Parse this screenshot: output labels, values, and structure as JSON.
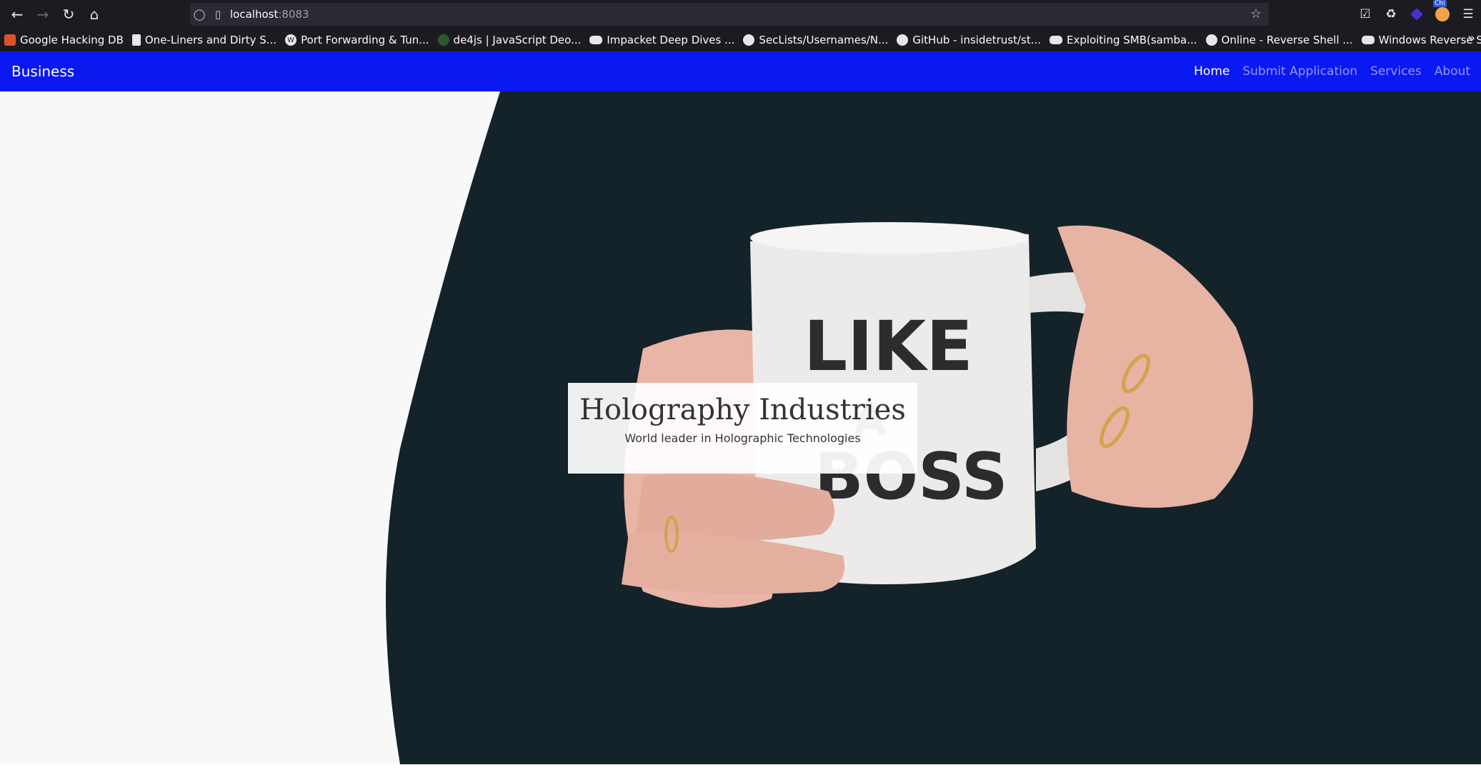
{
  "browser": {
    "url_host": "localhost",
    "url_port": ":8083",
    "bookmarks": [
      {
        "label": "Google Hacking DB",
        "icon": "ghdb-icon"
      },
      {
        "label": "One-Liners and Dirty S...",
        "icon": "document-icon"
      },
      {
        "label": "Port Forwarding & Tun...",
        "icon": "wordpress-icon"
      },
      {
        "label": "de4js | JavaScript Deo...",
        "icon": "de4js-icon"
      },
      {
        "label": "Impacket Deep Dives ...",
        "icon": "medium-icon"
      },
      {
        "label": "SecLists/Usernames/N...",
        "icon": "github-icon"
      },
      {
        "label": "GitHub - insidetrust/st...",
        "icon": "github-icon"
      },
      {
        "label": "Exploiting SMB(samba...",
        "icon": "medium-icon"
      },
      {
        "label": "Online - Reverse Shell ...",
        "icon": "skull-icon"
      },
      {
        "label": "Windows Reverse Shel...",
        "icon": "medium-icon"
      }
    ],
    "extension_badge": "Chi"
  },
  "site": {
    "brand": "Business",
    "nav": [
      {
        "label": "Home",
        "active": true
      },
      {
        "label": "Submit Application",
        "active": false
      },
      {
        "label": "Services",
        "active": false
      },
      {
        "label": "About",
        "active": false
      }
    ],
    "hero": {
      "title": "Holography Industries",
      "subtitle": "World leader in Holographic Technologies",
      "mug_text_1": "LIKE",
      "mug_text_2": "A",
      "mug_text_3": "BOSS"
    },
    "colors": {
      "navbar_bg": "#0a18f2",
      "nav_active": "#ffffff",
      "nav_inactive": "rgba(255,255,255,0.55)"
    }
  }
}
